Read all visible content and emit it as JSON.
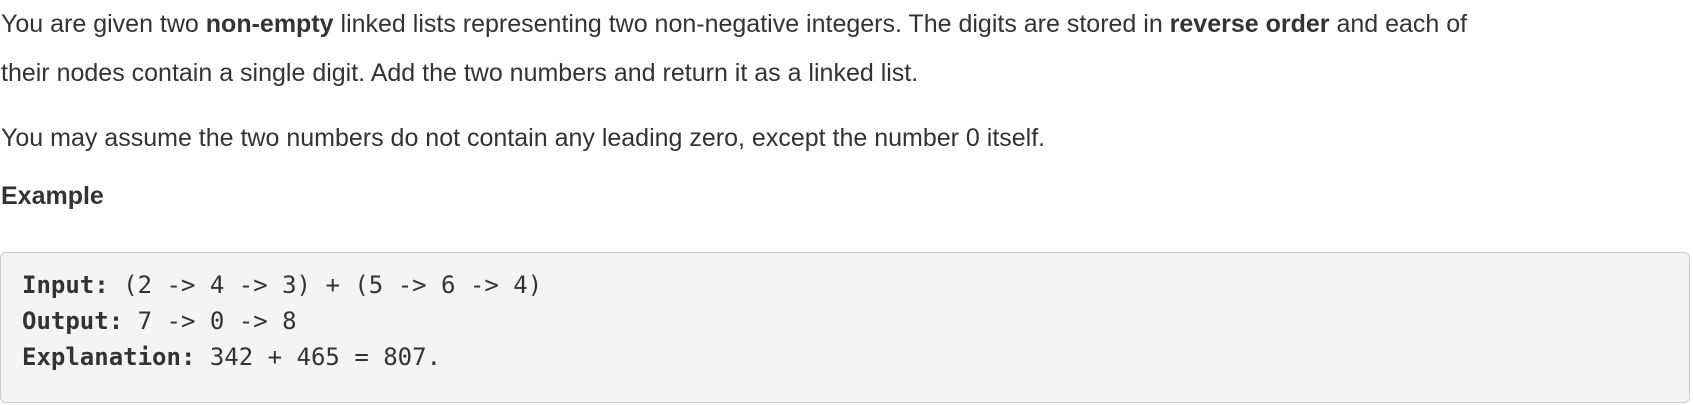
{
  "description": {
    "line1": {
      "t1": "You are given two ",
      "b1": "non-empty",
      "t2": " linked lists representing two non-negative integers. The digits are stored in ",
      "b2": "reverse order",
      "t3": " and each of"
    },
    "line2": "their nodes contain a single digit. Add the two numbers and return it as a linked list.",
    "note": "You may assume the two numbers do not contain any leading zero, except the number 0 itself."
  },
  "example": {
    "heading": "Example",
    "input_label": "Input:",
    "input_value": " (2 -> 4 -> 3) + (5 -> 6 -> 4)",
    "output_label": "Output:",
    "output_value": " 7 -> 0 -> 8",
    "explanation_label": "Explanation:",
    "explanation_value": " 342 + 465 = 807."
  }
}
